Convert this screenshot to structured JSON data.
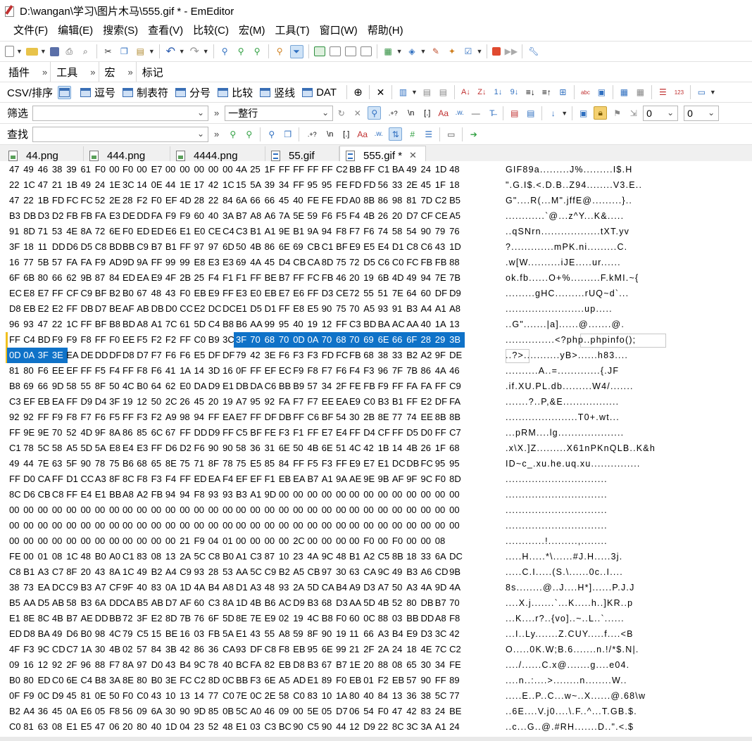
{
  "window": {
    "title": "D:\\wangan\\学习\\图片木马\\555.gif * - EmEditor"
  },
  "menu": [
    "文件(F)",
    "编辑(E)",
    "搜索(S)",
    "查看(V)",
    "比较(C)",
    "宏(M)",
    "工具(T)",
    "窗口(W)",
    "帮助(H)"
  ],
  "bars": {
    "plugins": "插件",
    "tools": "工具",
    "macro": "宏",
    "marks": "标记"
  },
  "csv": {
    "label": "CSV/排序",
    "items": [
      "逗号",
      "制表符",
      "分号",
      "比较",
      "竖线",
      "DAT"
    ]
  },
  "filter": {
    "label": "筛选",
    "value": "",
    "mode": "一整行",
    "left_num": "0",
    "right_num": "0"
  },
  "find": {
    "label": "查找",
    "value": ""
  },
  "tabs": [
    {
      "label": "44.png",
      "kind": "img"
    },
    {
      "label": "444.png",
      "kind": "img"
    },
    {
      "label": "4444.png",
      "kind": "img"
    },
    {
      "label": "55.gif",
      "kind": "doc"
    },
    {
      "label": "555.gif *",
      "kind": "doc",
      "active": true
    }
  ],
  "editor": {
    "selection_start": {
      "row": 11,
      "col": 16
    },
    "selection_end": {
      "row": 12,
      "col": 3
    },
    "hex_rows": [
      "47 49 46 38 39 61 F0 00 F0 00 E7 00 00 00 00 00 4A 25 1F FF FF FF FF C2 BB FF C1 BA 49 24 1D 48",
      "22 1C 47 21 1B 49 24 1E 3C 14 0E 44 1E 17 42 1C 15 5A 39 34 FF 95 95 FE FD FD 56 33 2E 45 1F 18",
      "47 22 1B FD FC FC 52 2E 28 F2 F0 EF 4D 28 22 84 6A 66 66 45 40 FE FE FD A0 8B 86 98 81 7D C2 B5",
      "B3 DB D3 D2 FB FB FA E3 DE DD FA F9 F9 60 40 3A B7 A8 A6 7A 5E 59 F6 F5 F4 4B 26 20 D7 CF CE A5",
      "91 8D 71 53 4E 8A 72 6E F0 ED ED E6 E1 E0 CE C4 C3 B1 A1 9E B1 9A 94 F8 F7 F6 74 58 54 90 79 76",
      "3F 18 11 DD D6 D5 C8 BD BB C9 B7 B1 FF 97 97 6D 50 4B 86 6E 69 CB C1 BF E9 E5 E4 D1 C8 C6 43 1D",
      "16 77 5B 57 FA FA F9 AD 9D 9A FF 99 99 E8 E3 E3 69 4A 45 D4 CB CA 8D 75 72 D5 C6 C0 FC FB FB 88",
      "6F 6B 80 66 62 9B 87 84 ED EA E9 4F 2B 25 F4 F1 F1 FF BE B7 FF FC FB 46 20 19 6B 4D 49 94 7E 7B",
      "EC E8 E7 FF CF C9 BF B2 B0 67 48 43 F0 EB E9 FF E3 E0 EB E7 E6 FF D3 CE 72 55 51 7E 64 60 DF D9",
      "D8 EB E2 E2 FF DB D7 BE AF AB DB D0 CC E2 DC DC E1 D5 D1 FF E8 E5 90 75 70 A5 93 91 B3 A4 A1 A8",
      "96 93 47 22 1C FF BF B8 BD A8 A1 7C 61 5D C4 B8 B6 AA 99 95 40 19 12 FF C3 BD BA AC AA 40 1A 13",
      "FF C4 BD F9 F9 F8 FF F0 EE F5 F2 F2 FF C0 B9 3C 3F 70 68 70 0D 0A 70 68 70 69 6E 66 6F 28 29 3B",
      "0D 0A 3F 3E EA DE DD DF D8 D7 F7 F6 F6 E5 DF DF 79 42 3E F6 F3 F3 FD FC FB 68 38 33 B2 A2 9F DE",
      "81 80 F6 EE EF FF F5 F4 FF F8 F6 41 1A 14 3D 16 0F FF EF EC F9 F8 F7 F6 F4 F3 96 7F 7B 86 4A 46",
      "B8 69 66 9D 58 55 8F 50 4C B0 64 62 E0 DA D9 E1 DB DA C6 BB B9 57 34 2F FE FB F9 FF FA FA FF C9",
      "C3 EF EB EA FF D9 D4 3F 19 12 50 2C 26 45 20 19 A7 95 92 FA F7 F7 EE EA E9 C0 B3 B1 FF E2 DF FA",
      "92 92 FF F9 F8 F7 F6 F5 FF F3 F2 A9 98 94 FF EA E7 FF DF DB FF C6 BF 54 30 2B 8E 77 74 EE 8B 8B",
      "FF 9E 9E 70 52 4D 9F 8A 86 85 6C 67 FF DD D9 FF C5 BF FE F3 F1 FF E7 E4 FF D4 CF FF D5 D0 FF C7",
      "C1 78 5C 58 A5 5D 5A E8 E4 E3 FF D6 D2 F6 90 90 58 36 31 6E 50 4B 6E 51 4C 42 1B 14 4B 26 1F 68",
      "49 44 7E 63 5F 90 78 75 B6 68 65 8E 75 71 8F 78 75 E5 85 84 FF F5 F3 FF E9 E7 E1 DC DB FC 95 95",
      "FF D0 CA FF D1 CC A3 8F 8C F8 F3 F4 FF ED EA F4 EF EF F1 EB EA B7 A1 9A AE 9E 9B AF 9F 9C F0 8D",
      "8C D6 CB C8 FF E4 E1 BB A8 A2 FB 94 94 F8 93 93 B3 A1 9D 00 00 00 00 00 00 00 00 00 00 00 00 00",
      "00 00 00 00 00 00 00 00 00 00 00 00 00 00 00 00 00 00 00 00 00 00 00 00 00 00 00 00 00 00 00 00",
      "00 00 00 00 00 00 00 00 00 00 00 00 00 00 00 00 00 00 00 00 00 00 00 00 00 00 00 00 00 00 00 00",
      "00 00 00 00 00 00 00 00 00 00 00 00 21 F9 04 01 00 00 00 00 2C 00 00 00 00 F0 00 F0 00 00 08",
      "FE 00 01 08 1C 48 B0 A0 C1 83 08 13 2A 5C C8 B0 A1 C3 87 10 23 4A 9C 48 B1 A2 C5 8B 18 33 6A DC",
      "C8 B1 A3 C7 8F 20 43 8A 1C 49 B2 A4 C9 93 28 53 AA 5C C9 B2 A5 CB 97 30 63 CA 9C 49 B3 A6 CD 9B",
      "38 73 EA DC C9 B3 A7 CF 9F 40 83 0A 1D 4A B4 A8 D1 A3 48 93 2A 5D CA B4 A9 D3 A7 50 A3 4A 9D 4A",
      "B5 AA D5 AB 58 B3 6A DD CA B5 AB D7 AF 60 C3 8A 1D 4B B6 AC D9 B3 68 D3 AA 5D 4B 52 80 DB B7 70",
      "E1 8E 8C 4B B7 AE DD BB 72 3F E2 8D 7B 76 6F 5D 8E 7E E9 02 19 4C B8 F0 60 0C 88 03 BB DD A8 F8",
      "ED D8 BA 49 D6 B0 98 4C 79 C5 15 BE 16 03 FB 5A E1 43 55 A8 59 8F 90 19 11 66 A3 B4 E9 D3 3C 42",
      "4F F3 9C CD C7 1A 30 4B 02 57 84 3B 42 86 36 CA 93 DF C8 F8 EB 95 6E 99 21 2F 2A 24 18 4E 7C C2",
      "09 16 12 92 2F 96 88 F7 8A 97 D0 43 B4 9C 78 40 BC FA 82 EB D8 B3 67 B7 1E 20 88 08 65 30 34 FE",
      "B0 80 ED C0 6E C4 B8 3A 8E 80 B0 3E FC C2 8D 0C BB F3 6E A5 AD E1 89 F0 EB 01 F2 EB 57 90 FF 89",
      "0F F9 0C D9 45 81 0E 50 F0 C0 43 10 13 14 77 C0 7E 0C 2E 58 C0 83 10 1A 80 40 84 13 36 38 5C 77",
      "B2 A4 36 45 0A E6 05 F8 56 09 6A 30 90 9D 85 0B 5C A0 46 09 00 5E 05 D7 06 54 F0 47 42 83 24 BE",
      "C0 81 63 08 E1 E5 47 06 20 80 40 1D 04 23 52 48 E1 03 C3 BC 90 C5 90 44 12 D9 22 8C 3C 3A A1 24"
    ],
    "ascii_rows": [
      "GIF89a.........J%.........I$.H",
      "\".G.I$.<.D.B..Z94........V3.E..",
      "G\"....R(...M\".jffE@.........}..",
      "............`@...z^Y...K&.....",
      "..qSNrn..................tXT.yv",
      "?.............mPK.ni.........C.",
      ".w[W..........iJE.....ur......",
      "ok.fb......O+%.........F.kMI.~{",
      ".........gHC.........rUQ~d`...",
      "........................up.....",
      "..G\".......|a]......@.......@.",
      "...............<?php..phpinfo();",
      "..?>...........yB>......h83....",
      "..........A..=.............{.JF",
      ".if.XU.PL.db.........W4/.......",
      ".......?..P,&E.................",
      "......................T0+.wt...",
      "...pRM....lg....................",
      ".x\\X.]Z.........X61nPKnQLB..K&h",
      "ID~c_.xu.he.uq.xu...............",
      "...............................",
      "...............................",
      "...............................",
      "...............................",
      "............!.........,........",
      ".....H.....*\\......#J.H.....3j.",
      ".....C.I.....(S.\\......0c..I....",
      "8s........@..J....H*]......P.J.J",
      "....X.j.......`...K.....h..]KR..p",
      "...K....r?..{vo]..~..L..`......",
      "...I..Ly.......Z.CUY.....f....<B",
      "O.....0K.W;B.6.......n.!/*$.N|.",
      "..../......C.x@.......g....e04.",
      "....n..:....>........n........W..",
      ".....E..P..C...w~..X......@.68\\w",
      "..6E....V.j0....\\.F..^...T.GB.$.",
      "..c...G..@.#RH.......D..\".<.$"
    ]
  }
}
